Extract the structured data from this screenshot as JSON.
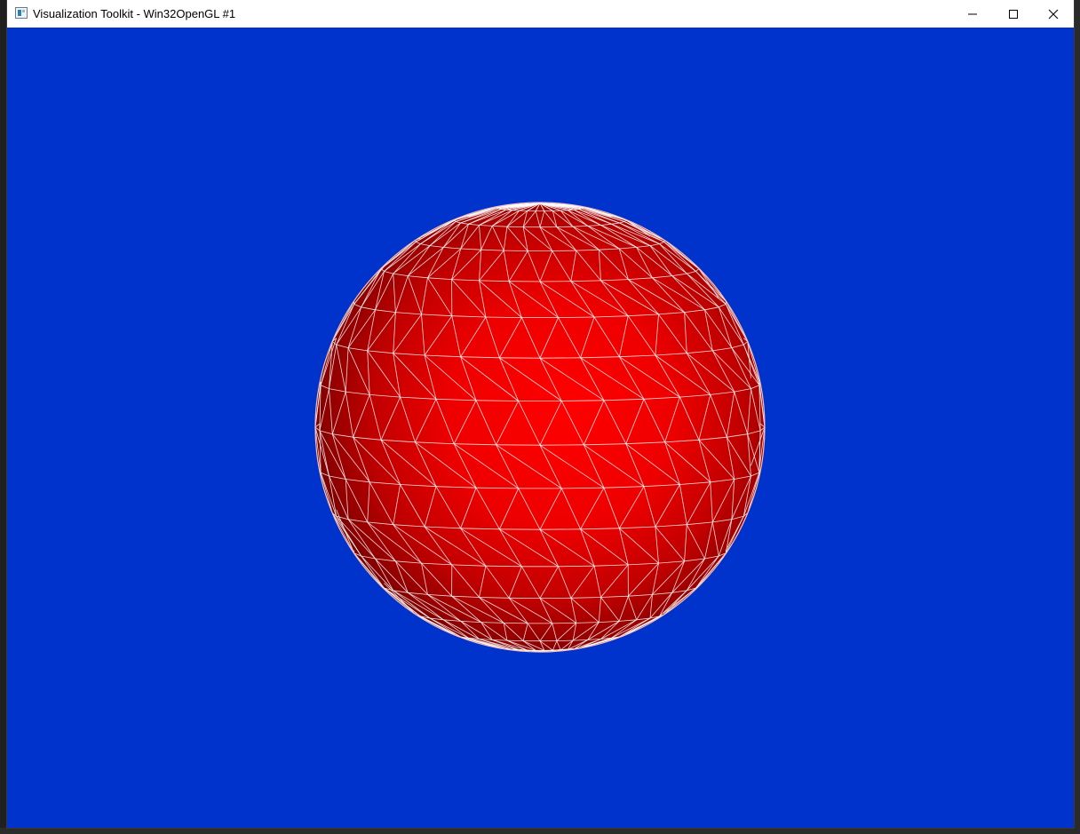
{
  "window": {
    "title": "Visualization Toolkit - Win32OpenGL #1",
    "icon": "vtk-app-icon",
    "controls": [
      "minimize-icon",
      "maximize-icon",
      "close-icon"
    ]
  },
  "viewport": {
    "background_color": "#0033cc",
    "object": "sphere",
    "object_color": "#ff0000",
    "wireframe_color": "#ffffff"
  }
}
